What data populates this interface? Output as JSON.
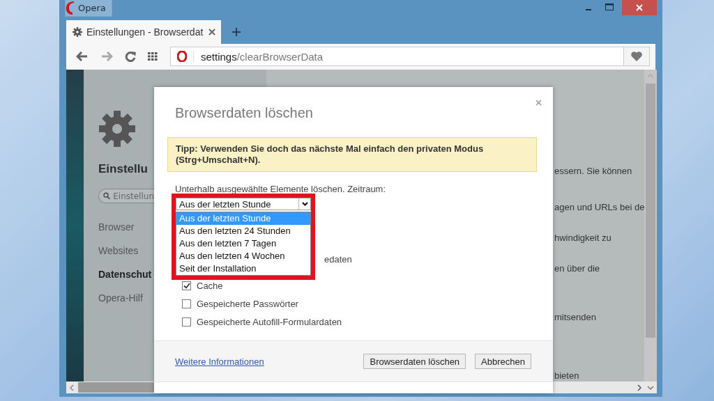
{
  "window": {
    "title": "Opera"
  },
  "tabs": [
    {
      "label": "Einstellungen - Browserdat",
      "selected": true
    }
  ],
  "address_bar": {
    "host": "settings",
    "path": "/clearBrowserData"
  },
  "sidebar": {
    "title": "Einstellu",
    "search_placeholder": "Einstellun",
    "items": [
      {
        "label": "Browser",
        "selected": false
      },
      {
        "label": "Websites",
        "selected": false
      },
      {
        "label": "Datenschut",
        "selected": true
      },
      {
        "label": "Opera-Hilf",
        "selected": false
      }
    ]
  },
  "background_texts": [
    "essern. Sie können",
    "agen und URLs bei de",
    "hwindigkeit zu",
    "en über die",
    "mitsenden",
    "bieten"
  ],
  "dialog": {
    "title": "Browserdaten löschen",
    "tip": "Tipp: Verwenden Sie doch das nächste Mal einfach den privaten Modus (Strg+Umschalt+N).",
    "period_label": "Unterhalb ausgewählte Elemente löschen. Zeitraum:",
    "period_select": {
      "value": "Aus der letzten Stunde",
      "expanded": true,
      "options": [
        {
          "label": "Aus der letzten Stunde",
          "selected": true
        },
        {
          "label": "Aus den letzten 24 Stunden",
          "selected": false
        },
        {
          "label": "Aus den letzten 7 Tagen",
          "selected": false
        },
        {
          "label": "Aus den letzten 4 Wochen",
          "selected": false
        },
        {
          "label": "Seit der Installation",
          "selected": false
        }
      ]
    },
    "items": [
      {
        "kind": "partial",
        "label": "edaten"
      },
      {
        "kind": "checkbox",
        "label": "Cache",
        "checked": true
      },
      {
        "kind": "checkbox",
        "label": "Gespeicherte Passwörter",
        "checked": false
      },
      {
        "kind": "checkbox",
        "label": "Gespeicherte Autofill-Formulardaten",
        "checked": false
      }
    ],
    "link": "Weitere Informationen",
    "buttons": [
      "Browserdaten löschen",
      "Abbrechen"
    ]
  }
}
